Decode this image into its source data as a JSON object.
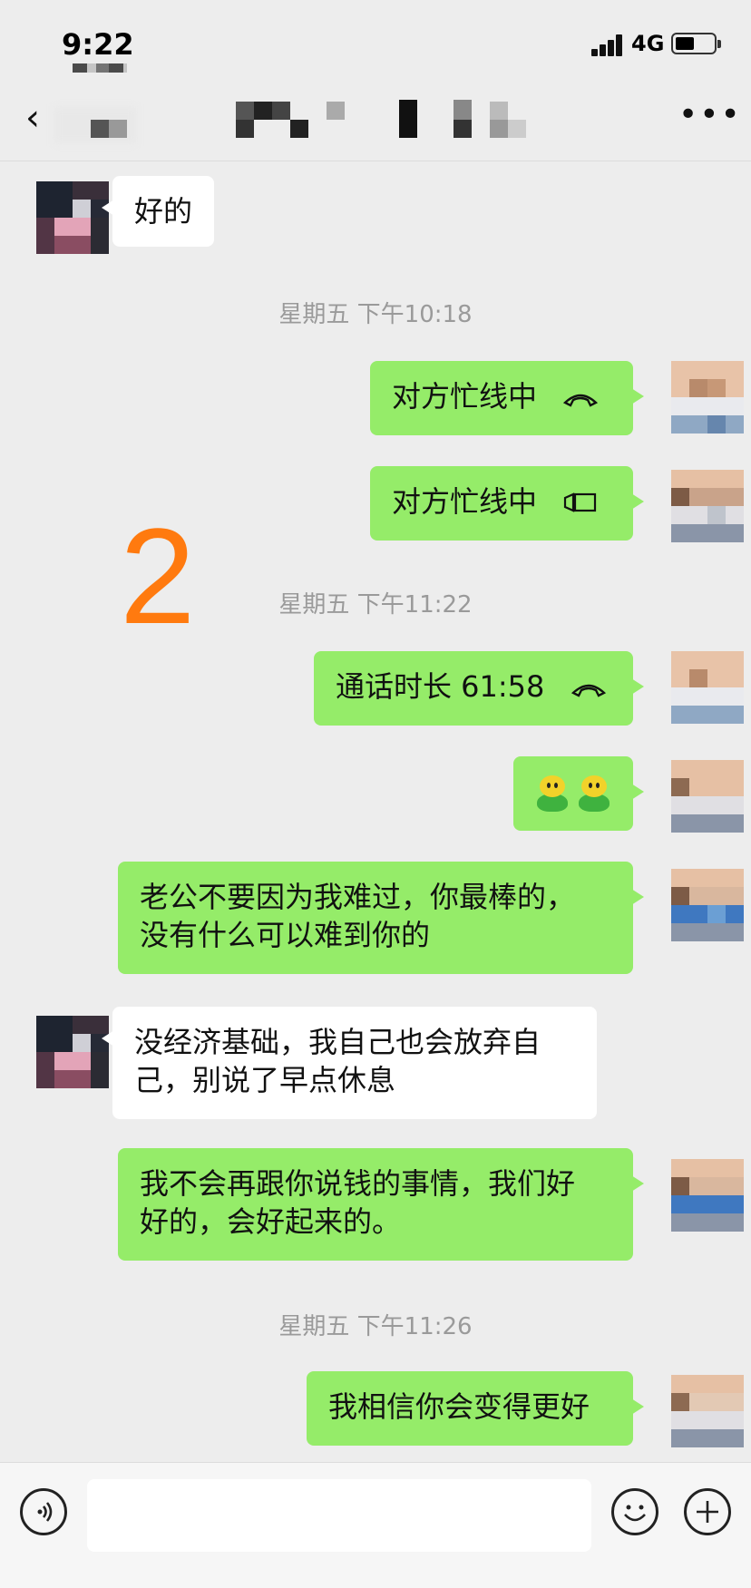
{
  "status_bar": {
    "time": "9:22",
    "network": "4G",
    "icons": [
      "signal-icon",
      "battery-icon"
    ]
  },
  "nav": {
    "back_icon": "chevron-left-icon",
    "more_icon": "more-dots-icon",
    "title": ""
  },
  "overlay_number": "2",
  "messages": [
    {
      "side": "them",
      "text": "好的"
    },
    {
      "type": "timestamp",
      "text": "星期五 下午10:18"
    },
    {
      "side": "me",
      "text": "对方忙线中",
      "icon": "phone-hangup-icon"
    },
    {
      "side": "me",
      "text": "对方忙线中",
      "icon": "video-call-icon"
    },
    {
      "type": "timestamp",
      "text": "星期五 下午11:22"
    },
    {
      "side": "me",
      "text": "通话时长 61:58",
      "icon": "phone-hangup-icon"
    },
    {
      "side": "me",
      "type": "emoji",
      "icons": [
        "green-sprout-emoji-icon",
        "green-sprout-emoji-icon"
      ]
    },
    {
      "side": "me",
      "lines": [
        "老公不要因为我难过，你最棒的，",
        "没有什么可以难到你的"
      ]
    },
    {
      "side": "them",
      "lines": [
        "没经济基础，我自己也会放弃自",
        "己，别说了早点休息"
      ]
    },
    {
      "side": "me",
      "lines": [
        "我不会再跟你说钱的事情，我们好",
        "好的，会好起来的。"
      ]
    },
    {
      "type": "timestamp",
      "text": "星期五 下午11:26"
    },
    {
      "side": "me",
      "text": "我相信你会变得更好"
    }
  ],
  "input_bar": {
    "voice_icon": "voice-icon",
    "emoji_icon": "smiley-icon",
    "plus_icon": "plus-icon"
  },
  "colors": {
    "me_bubble": "#95ec69",
    "them_bubble": "#ffffff",
    "background": "#ededed",
    "overlay": "#ff7a0f"
  }
}
